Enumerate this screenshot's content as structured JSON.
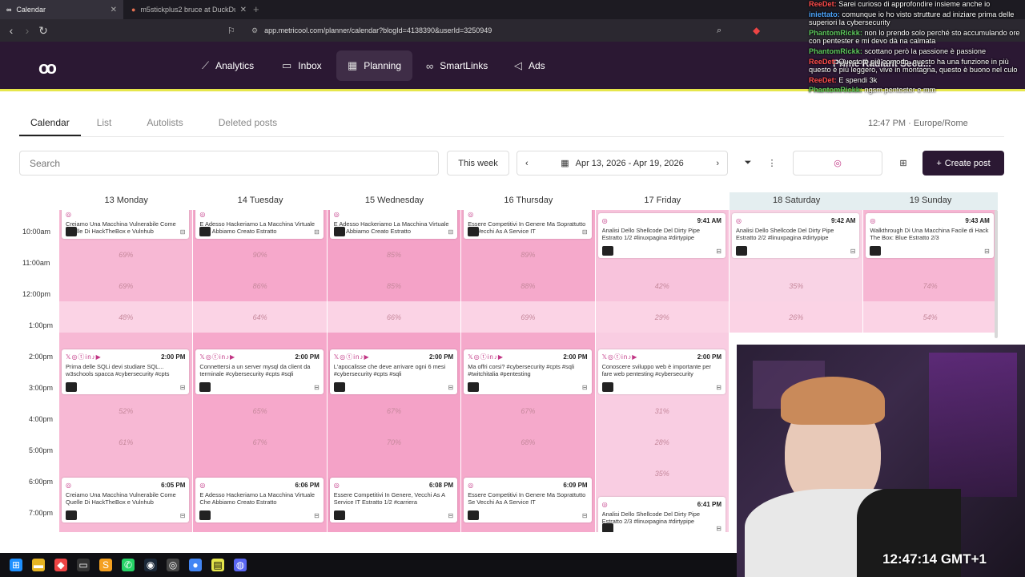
{
  "browser": {
    "tabs": [
      {
        "label": "Calendar"
      },
      {
        "label": "m5stickplus2 bruce at DuckDuckGo"
      }
    ],
    "url": "app.metricool.com/planner/calendar?blogId=4138390&userId=3250949"
  },
  "nav": {
    "items": [
      {
        "label": "Analytics",
        "icon": "chart-line-icon"
      },
      {
        "label": "Inbox",
        "icon": "chat-icon"
      },
      {
        "label": "Planning",
        "icon": "calendar-icon",
        "active": true
      },
      {
        "label": "SmartLinks",
        "icon": "link-icon"
      },
      {
        "label": "Ads",
        "icon": "megaphone-icon"
      }
    ]
  },
  "subtabs": [
    "Calendar",
    "List",
    "Autolists",
    "Deleted posts"
  ],
  "toolbar": {
    "search_placeholder": "Search",
    "this_week": "This week",
    "date_range": "Apr 13, 2026 - Apr 19, 2026",
    "create_post": "Create post"
  },
  "days": [
    {
      "label": "13 Monday"
    },
    {
      "label": "14 Tuesday"
    },
    {
      "label": "15 Wednesday"
    },
    {
      "label": "16 Thursday"
    },
    {
      "label": "17 Friday"
    },
    {
      "label": "18 Saturday"
    },
    {
      "label": "19 Sunday"
    }
  ],
  "hours": [
    "10:00am",
    "11:00am",
    "12:00pm",
    "1:00pm",
    "2:00pm",
    "3:00pm",
    "4:00pm",
    "5:00pm",
    "6:00pm",
    "7:00pm"
  ],
  "percentages": {
    "h11": [
      "69%",
      "90%",
      "85%",
      "89%",
      "42%",
      "33%",
      "76%"
    ],
    "h12": [
      "69%",
      "86%",
      "85%",
      "88%",
      "42%",
      "35%",
      "74%"
    ],
    "h13": [
      "48%",
      "64%",
      "66%",
      "69%",
      "29%",
      "26%",
      "54%"
    ],
    "h16": [
      "52%",
      "65%",
      "67%",
      "67%",
      "31%"
    ],
    "h17": [
      "61%",
      "67%",
      "70%",
      "68%",
      "28%"
    ],
    "h18": [
      "",
      "",
      "",
      "",
      "35%"
    ]
  },
  "posts_top": [
    {
      "text": "Creiamo Una Macchina Vulnerabile Come Quelle Di HackTheBox e Vulnhub",
      "time": ""
    },
    {
      "text": "E Adesso Hackeriamo La Macchina Virtuale Che Abbiamo Creato Estratto",
      "time": ""
    },
    {
      "text": "E Adesso Hackeriamo La Macchina Virtuale Che Abbiamo Creato Estratto",
      "time": ""
    },
    {
      "text": "Essere Competitivi In Genere Ma Soprattutto Se Vecchi As A Service IT",
      "time": ""
    },
    {
      "text": "Analisi Dello Shellcode Del Dirty Pipe Estratto 1/2 #linuxpagina #dirtypipe",
      "time": "9:41 AM"
    },
    {
      "text": "Analisi Dello Shellcode Del Dirty Pipe Estratto 2/2 #linuxpagina #dirtypipe",
      "time": "9:42 AM"
    },
    {
      "text": "Walkthrough Di Una Macchina Facile di Hack The Box: Blue Estratto 2/3",
      "time": "9:43 AM"
    }
  ],
  "posts_2pm": [
    {
      "text": "Prima delle SQLi devi studiare SQL... w3schools spacca #cybersecurity #cpts",
      "time": "2:00 PM"
    },
    {
      "text": "Connettersi a un server mysql da client da terminale #cybersecurity #cpts #sqli",
      "time": "2:00 PM"
    },
    {
      "text": "L'apocalisse che deve arrivare ogni 6 mesi #cybersecurity #cpts #sqli",
      "time": "2:00 PM"
    },
    {
      "text": "Ma offri corsi? #cybersecurity #cpts #sqli #twitchitalia #pentesting",
      "time": "2:00 PM"
    },
    {
      "text": "Conoscere sviluppo web è importante per fare web pentesting #cybersecurity",
      "time": "2:00 PM"
    }
  ],
  "posts_6pm": [
    {
      "text": "Creiamo Una Macchina Vulnerabile Come Quelle Di HackTheBox e Vulnhub",
      "time": "6:05 PM"
    },
    {
      "text": "E Adesso Hackeriamo La Macchina Virtuale Che Abbiamo Creato Estratto",
      "time": "6:06 PM"
    },
    {
      "text": "Essere Competitivi In Genere, Vecchi As A Service IT Estratto 1/2 #carriera",
      "time": "6:08 PM"
    },
    {
      "text": "Essere Competitivi In Genere Ma Soprattutto Se Vecchi As A Service IT",
      "time": "6:09 PM"
    },
    {
      "text": "Analisi Dello Shellcode Del Dirty Pipe Estratto 2/3 #linuxpagina #dirtypipe",
      "time": "6:41 PM"
    }
  ],
  "chat": [
    {
      "user": "ReeDet:",
      "msg": "Sarei curioso di approfondire insieme anche io",
      "color": "#ff4d4d"
    },
    {
      "user": "iniettato:",
      "msg": "comunque io ho visto strutture ad iniziare prima delle superiori la cybersecurity",
      "color": "#4da6ff"
    },
    {
      "user": "PhantomRickk:",
      "msg": "non lo prendo solo perché sto accumulando ore con pentester e mi devo dà na calmata",
      "color": "#5ec95e"
    },
    {
      "user": "PhantomRickk:",
      "msg": "scottano però la passione è passione",
      "color": "#5ec95e"
    },
    {
      "user": "ReeDet:",
      "msg": "Questo è più comodo, questo ha una funzione in più questo è più leggero, vive in montagna, questo è buono nel culo",
      "color": "#ff4d4d"
    },
    {
      "user": "ReeDet:",
      "msg": "E spendi 3k",
      "color": "#ff4d4d"
    },
    {
      "user": "PhantomRickk:",
      "msg": "ngsm pentester e mm",
      "color": "#5ec95e"
    }
  ],
  "overlay": {
    "name": "Prime Radiant Secu...",
    "clock_small": "12:47 PM · Europe/Rome",
    "cam_clock": "12:47:14 GMT+1"
  }
}
